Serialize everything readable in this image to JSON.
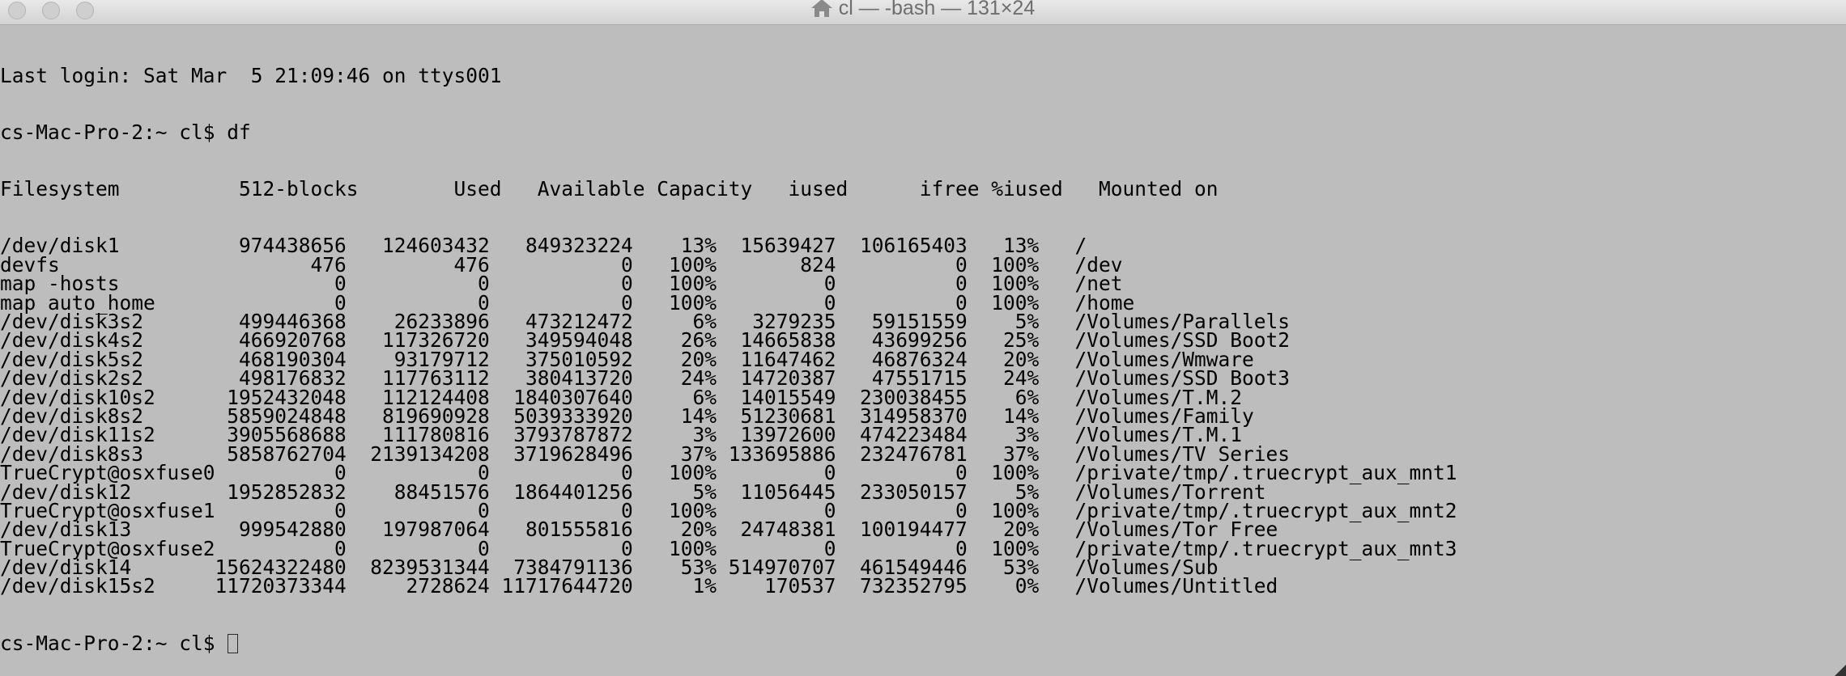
{
  "window": {
    "title": "cl — -bash — 131×24"
  },
  "icons": {
    "title_icon": "home-icon"
  },
  "terminal": {
    "last_login": "Last login: Sat Mar  5 21:09:46 on ttys001",
    "prompt": "cs-Mac-Pro-2:~ cl$ ",
    "command": "df",
    "df_header": "Filesystem          512-blocks        Used   Available Capacity   iused      ifree %iused   Mounted on",
    "df_rows": [
      "/dev/disk1          974438656   124603432   849323224    13%  15639427  106165403   13%   /",
      "devfs                     476         476           0   100%       824          0  100%   /dev",
      "map -hosts                  0           0           0   100%         0          0  100%   /net",
      "map auto_home               0           0           0   100%         0          0  100%   /home",
      "/dev/disk3s2        499446368    26233896   473212472     6%   3279235   59151559    5%   /Volumes/Parallels",
      "/dev/disk4s2        466920768   117326720   349594048    26%  14665838   43699256   25%   /Volumes/SSD Boot2",
      "/dev/disk5s2        468190304    93179712   375010592    20%  11647462   46876324   20%   /Volumes/Wmware",
      "/dev/disk2s2        498176832   117763112   380413720    24%  14720387   47551715   24%   /Volumes/SSD Boot3",
      "/dev/disk10s2      1952432048   112124408  1840307640     6%  14015549  230038455    6%   /Volumes/T.M.2",
      "/dev/disk8s2       5859024848   819690928  5039333920    14%  51230681  314958370   14%   /Volumes/Family",
      "/dev/disk11s2      3905568688   111780816  3793787872     3%  13972600  474223484    3%   /Volumes/T.M.1",
      "/dev/disk8s3       5858762704  2139134208  3719628496    37% 133695886  232476781   37%   /Volumes/TV Series",
      "TrueCrypt@osxfuse0          0           0           0   100%         0          0  100%   /private/tmp/.truecrypt_aux_mnt1",
      "/dev/disk12        1952852832    88451576  1864401256     5%  11056445  233050157    5%   /Volumes/Torrent",
      "TrueCrypt@osxfuse1          0           0           0   100%         0          0  100%   /private/tmp/.truecrypt_aux_mnt2",
      "/dev/disk13         999542880   197987064   801555816    20%  24748381  100194477   20%   /Volumes/Tor Free",
      "TrueCrypt@osxfuse2          0           0           0   100%         0          0  100%   /private/tmp/.truecrypt_aux_mnt3",
      "/dev/disk14       15624322480  8239531344  7384791136    53% 514970707  461549446   53%   /Volumes/Sub",
      "/dev/disk15s2     11720373344     2728624 11717644720     1%    170537  732352795    0%   /Volumes/Untitled"
    ]
  }
}
